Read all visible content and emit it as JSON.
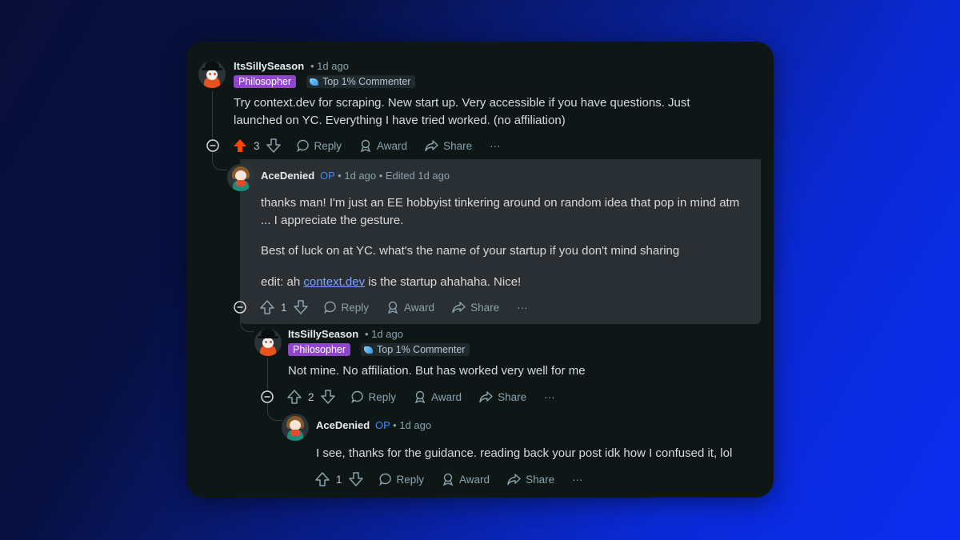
{
  "comments": [
    {
      "username": "ItsSillySeason",
      "time": "1d ago",
      "flairs": {
        "role": "Philosopher",
        "badge": "Top 1% Commenter"
      },
      "text": "Try context.dev for scraping. New start up. Very accessible if you have questions. Just launched on YC. Everything I have tried worked. (no affiliation)",
      "votes": "3",
      "upvoted": true,
      "actions": {
        "reply": "Reply",
        "award": "Award",
        "share": "Share",
        "more": "···"
      }
    },
    {
      "username": "AceDenied",
      "op": "OP",
      "time": "1d ago",
      "edited": "Edited 1d ago",
      "paragraph1": "thanks man! I'm just an EE hobbyist tinkering around on random idea that pop in mind atm ... I appreciate the gesture.",
      "paragraph2": "Best of luck on at YC. what's the name of your startup if you don't mind sharing",
      "paragraph3_prefix": "edit: ah ",
      "paragraph3_link": "context.dev",
      "paragraph3_suffix": " is the startup ahahaha. Nice!",
      "votes": "1",
      "actions": {
        "reply": "Reply",
        "award": "Award",
        "share": "Share",
        "more": "···"
      }
    },
    {
      "username": "ItsSillySeason",
      "time": "1d ago",
      "flairs": {
        "role": "Philosopher",
        "badge": "Top 1% Commenter"
      },
      "text": "Not mine. No affiliation. But has worked very well for me",
      "votes": "2",
      "actions": {
        "reply": "Reply",
        "award": "Award",
        "share": "Share",
        "more": "···"
      }
    },
    {
      "username": "AceDenied",
      "op": "OP",
      "time": "1d ago",
      "text": "I see, thanks for the guidance. reading back your post idk how I confused it, lol",
      "votes": "1",
      "actions": {
        "reply": "Reply",
        "award": "Award",
        "share": "Share",
        "more": "···"
      }
    }
  ],
  "colors": {
    "upvote_active": "#ff4500",
    "op_blue": "#3d8bff",
    "philosopher_flair": "#9046c9",
    "card_bg": "#0e1716",
    "highlight_bg": "#2a2f33"
  },
  "icons": [
    "collapse-icon",
    "upvote-icon",
    "downvote-icon",
    "reply-icon",
    "award-icon",
    "share-icon",
    "more-icon",
    "top-commenter-icon"
  ]
}
